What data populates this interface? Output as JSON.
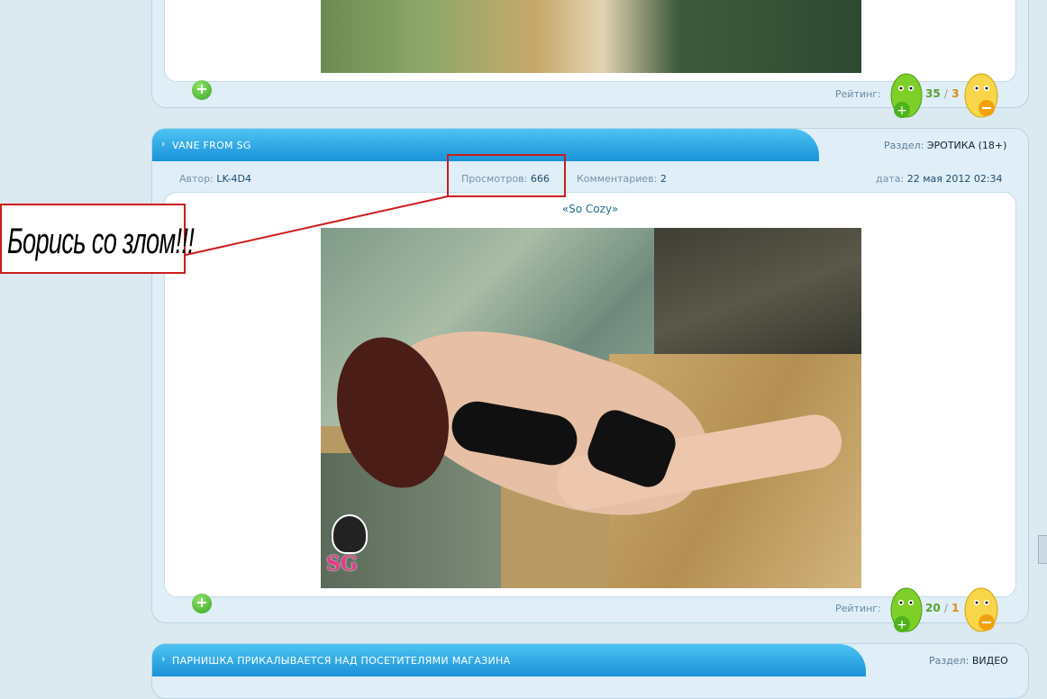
{
  "prev_post": {
    "rating_label": "Рейтинг:",
    "score_plus": "35",
    "score_sep": "/",
    "score_minus": "3"
  },
  "post": {
    "title": "VANE FROM SG",
    "section_label": "Раздел:",
    "section_value": "ЭРОТИКА (18+)",
    "author_label": "Автор:",
    "author": "LK-4D4",
    "views_label": "Просмотров:",
    "views": "666",
    "comments_label": "Комментариев:",
    "comments": "2",
    "date_label": "дата:",
    "date": "22 мая 2012 02:34",
    "caption": "«So Cozy»",
    "watermark": "SG",
    "rating_label": "Рейтинг:",
    "score_plus": "20",
    "score_sep": "/",
    "score_minus": "1"
  },
  "next_post": {
    "title": "ПАРНИШКА ПРИКАЛЫВАЕТСЯ НАД ПОСЕТИТЕЛЯМИ МАГАЗИНА",
    "section_label": "Раздел:",
    "section_value": "ВИДЕО"
  },
  "annotation": {
    "text": "Борись со злом!!!"
  },
  "colors": {
    "accent_blue": "#1a92d8",
    "highlight_red": "#cc1d1d",
    "plus_green": "#5aa02c",
    "minus_orange": "#e08a10"
  }
}
